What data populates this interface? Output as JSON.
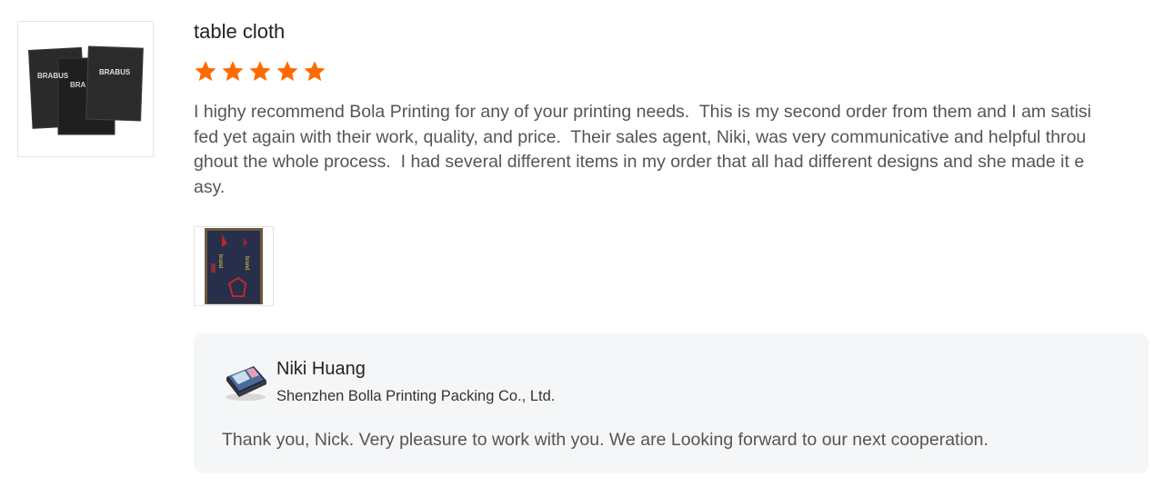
{
  "review": {
    "product_thumbnail": {
      "icon": "product-photo-icon",
      "brand_text": "BRABUS"
    },
    "title": "table cloth",
    "rating": 5,
    "rating_max": 5,
    "star_color": "#ff6a00",
    "body": "I highy recommend Bola Printing for any of your printing needs.  This is my second order from them and I am satisifed yet again with their work, quality, and price.  Their sales agent, Niki, was very communicative and helpful throughout the whole process.  I had several different items in my order that all had different designs and she made it easy.",
    "attachment_icon": "attachment-photo-icon"
  },
  "reply": {
    "avatar_icon": "seller-avatar-icon",
    "name": "Niki Huang",
    "company": "Shenzhen Bolla Printing Packing Co., Ltd.",
    "text": "Thank you, Nick. Very pleasure to work with you. We are Looking forward to our next cooperation."
  }
}
